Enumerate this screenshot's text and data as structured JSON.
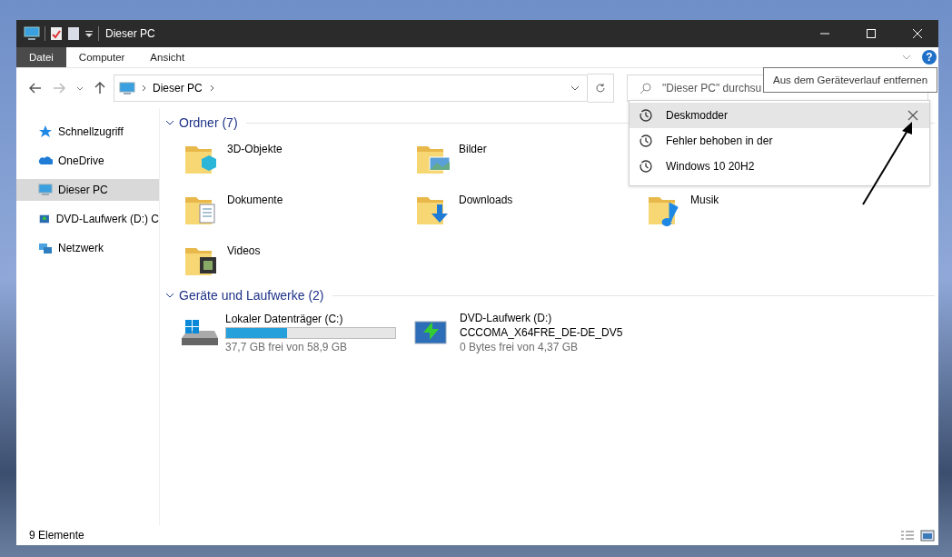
{
  "window": {
    "title": "Dieser PC"
  },
  "ribbon_tabs": [
    {
      "label": "Datei",
      "selected": true
    },
    {
      "label": "Computer",
      "selected": false
    },
    {
      "label": "Ansicht",
      "selected": false
    }
  ],
  "address": {
    "crumbs": [
      "Dieser PC"
    ]
  },
  "search": {
    "placeholder": "\"Dieser PC\" durchsu"
  },
  "help_button": "?",
  "tooltip": "Aus dem Geräteverlauf entfernen",
  "search_history": [
    {
      "label": "Deskmodder",
      "selected": true
    },
    {
      "label": "Fehler behoben in der",
      "selected": false
    },
    {
      "label": "Windows 10 20H2",
      "selected": false
    }
  ],
  "sidebar": {
    "items": [
      {
        "label": "Schnellzugriff",
        "kind": "star",
        "selected": false
      },
      {
        "label": "OneDrive",
        "kind": "cloud",
        "selected": false
      },
      {
        "label": "Dieser PC",
        "kind": "pc",
        "selected": true
      },
      {
        "label": "DVD-Laufwerk (D:) C",
        "kind": "dvd",
        "selected": false
      },
      {
        "label": "Netzwerk",
        "kind": "network",
        "selected": false
      }
    ]
  },
  "folders": {
    "heading": "Ordner (7)",
    "rows": [
      [
        {
          "name": "3D-Objekte",
          "kind": "objects"
        },
        {
          "name": "Bilder",
          "kind": "pictures"
        }
      ],
      [
        {
          "name": "Dokumente",
          "kind": "documents"
        },
        {
          "name": "Downloads",
          "kind": "downloads"
        },
        {
          "name": "Musik",
          "kind": "music"
        }
      ],
      [
        {
          "name": "Videos",
          "kind": "videos"
        }
      ]
    ]
  },
  "drives": {
    "heading": "Geräte und Laufwerke (2)",
    "items": [
      {
        "kind": "disk",
        "name": "Lokaler Datenträger (C:)",
        "level": 0.36,
        "free": "37,7 GB frei von 58,9 GB"
      },
      {
        "kind": "dvd",
        "name": "DVD-Laufwerk (D:)",
        "label": "CCCOMA_X64FRE_DE-DE_DV5",
        "free": "0 Bytes frei von 4,37 GB"
      }
    ]
  },
  "status_bar": {
    "text": "9 Elemente"
  }
}
